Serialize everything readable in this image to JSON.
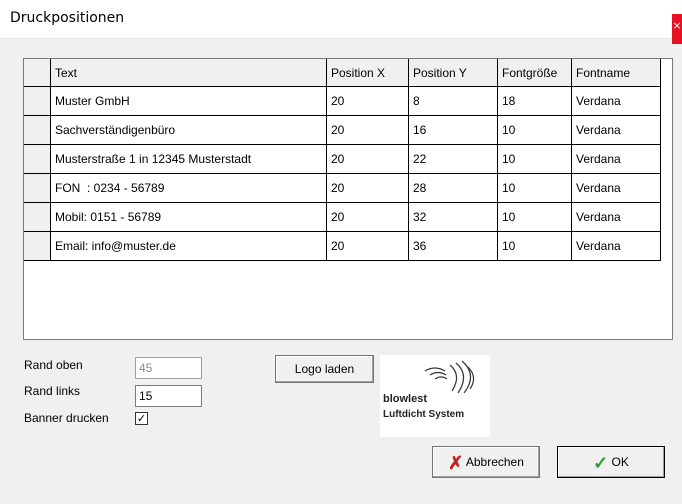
{
  "window": {
    "title": "Druckpositionen",
    "close_label": "×"
  },
  "grid": {
    "columns": [
      "Text",
      "Position X",
      "Position Y",
      "Fontgröße",
      "Fontname"
    ],
    "rows": [
      [
        "Muster GmbH",
        "20",
        "8",
        "18",
        "Verdana"
      ],
      [
        "Sachverständigenbüro",
        "20",
        "16",
        "10",
        "Verdana"
      ],
      [
        "Musterstraße 1 in 12345 Musterstadt",
        "20",
        "22",
        "10",
        "Verdana"
      ],
      [
        "FON  : 0234 - 56789",
        "20",
        "28",
        "10",
        "Verdana"
      ],
      [
        "Mobil: 0151 - 56789",
        "20",
        "32",
        "10",
        "Verdana"
      ],
      [
        "Email: info@muster.de",
        "20",
        "36",
        "10",
        "Verdana"
      ]
    ]
  },
  "form": {
    "rand_oben_label": "Rand oben",
    "rand_oben_value": "45",
    "rand_links_label": "Rand links",
    "rand_links_value": "15",
    "banner_label": "Banner drucken",
    "banner_checked": true,
    "logo_button": "Logo laden"
  },
  "logo": {
    "brand": "blowlest",
    "tagline": "Luftdicht System"
  },
  "footer": {
    "cancel_label": "Abbrechen",
    "ok_label": "OK"
  },
  "colors": {
    "cancel_icon": "#c0261c",
    "ok_icon": "#2e9e2e",
    "close_bg": "#e81123"
  }
}
